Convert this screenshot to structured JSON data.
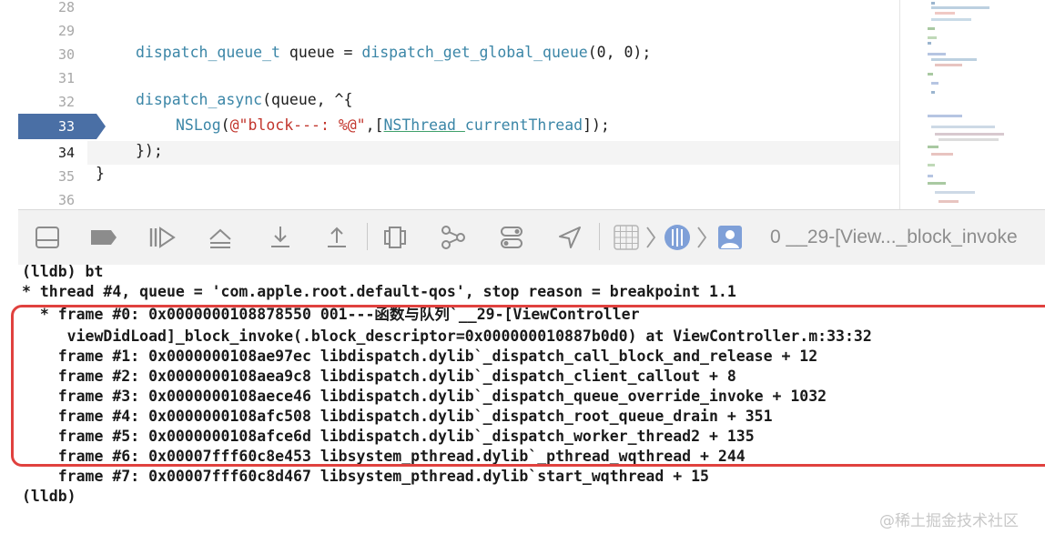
{
  "editor": {
    "line_numbers": [
      "28",
      "29",
      "30",
      "31",
      "32",
      "33",
      "34",
      "35",
      "36"
    ],
    "breakpoint_line": "33",
    "lines": {
      "l30": {
        "type": "dispatch_queue_t",
        "plain1": " queue = ",
        "fn": "dispatch_get_global_queue",
        "plain2": "(0, 0);"
      },
      "l32": {
        "fn": "dispatch_async",
        "plain": "(queue, ^{"
      },
      "l33": {
        "fn": "NSLog",
        "p1": "(",
        "str": "@\"block---: %@\"",
        "p2": ",[",
        "cls": "NSThread",
        "sp": " ",
        "fn2": "currentThread",
        "p3": "]);"
      },
      "l34": {
        "plain": "});"
      },
      "l35": {
        "plain": "}"
      }
    }
  },
  "toolbar": {
    "icons": [
      "toggle-console-icon",
      "breakpoint-tag-icon",
      "continue-icon",
      "step-over-icon",
      "step-into-icon",
      "step-out-icon",
      "view-hierarchy-icon",
      "memory-graph-icon",
      "environment-overrides-icon",
      "location-icon"
    ],
    "breadcrumb_text": "0 __29-[View..._block_invoke"
  },
  "console": {
    "lines": [
      "(lldb) bt",
      "* thread #4, queue = 'com.apple.root.default-qos', stop reason = breakpoint 1.1",
      "  * frame #0: 0x0000000108878550 001---函数与队列`__29-[ViewController",
      "     viewDidLoad]_block_invoke(.block_descriptor=0x000000010887b0d0) at ViewController.m:33:32",
      "    frame #1: 0x0000000108ae97ec libdispatch.dylib`_dispatch_call_block_and_release + 12",
      "    frame #2: 0x0000000108aea9c8 libdispatch.dylib`_dispatch_client_callout + 8",
      "    frame #3: 0x0000000108aece46 libdispatch.dylib`_dispatch_queue_override_invoke + 1032",
      "    frame #4: 0x0000000108afc508 libdispatch.dylib`_dispatch_root_queue_drain + 351",
      "    frame #5: 0x0000000108afce6d libdispatch.dylib`_dispatch_worker_thread2 + 135",
      "    frame #6: 0x00007fff60c8e453 libsystem_pthread.dylib`_pthread_wqthread + 244",
      "    frame #7: 0x00007fff60c8d467 libsystem_pthread.dylib`start_wqthread + 15",
      "(lldb)"
    ]
  },
  "colors": {
    "highlight_box": "#e0413e",
    "breakpoint": "#4a6fa5",
    "keyword_blue": "#3b86a7",
    "string_red": "#c2352c"
  },
  "watermark": "@稀土掘金技术社区"
}
